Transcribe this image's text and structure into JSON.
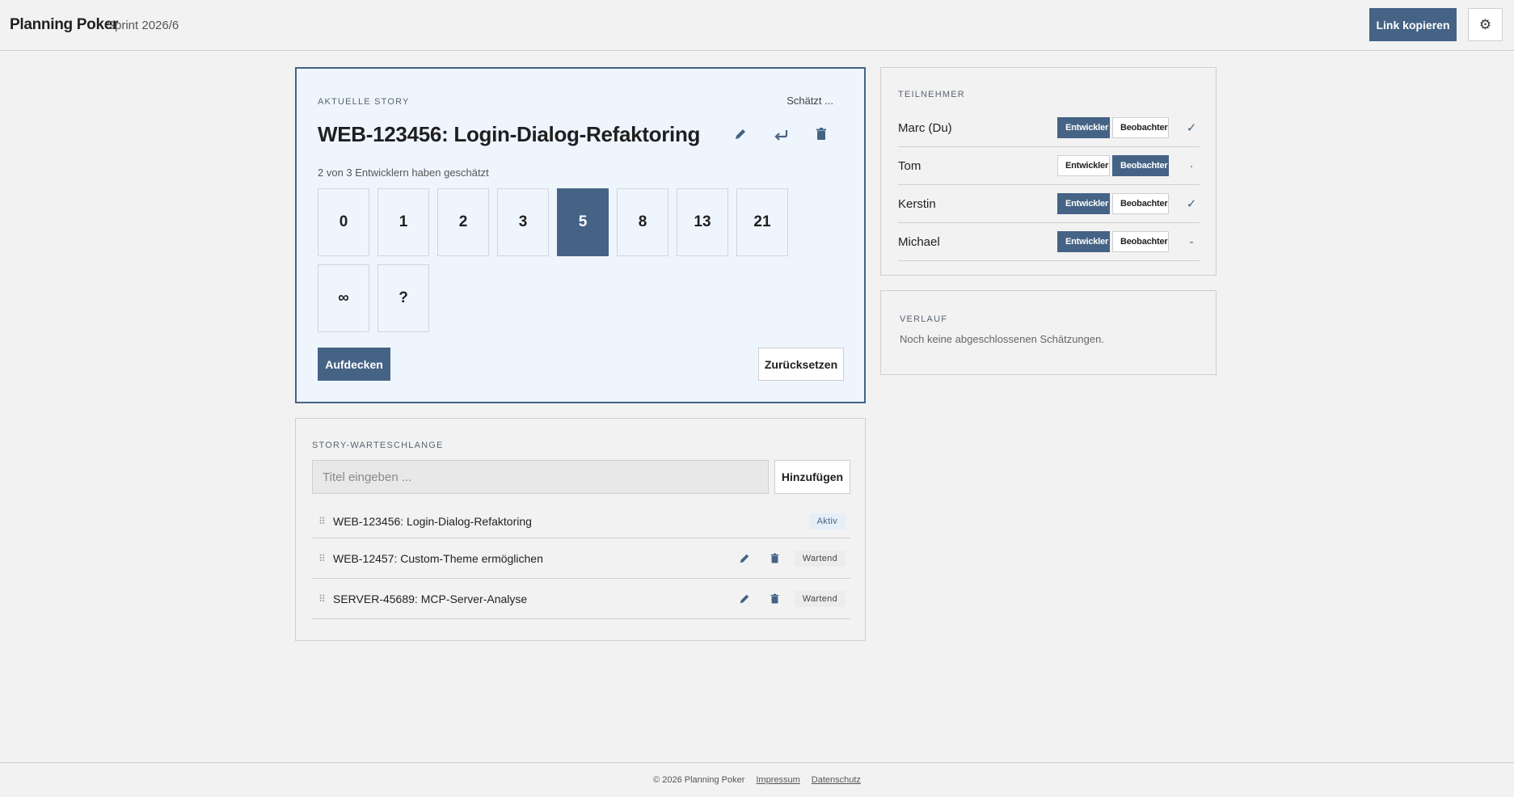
{
  "header": {
    "app_title": "Planning Poker",
    "sprint": "Sprint 2026/6",
    "copy_link_label": "Link kopieren",
    "settings_icon": "gear-icon"
  },
  "story": {
    "section_label": "AKTUELLE STORY",
    "status": "Schätzt ...",
    "title": "WEB-123456: Login-Dialog-Refaktoring",
    "icons": [
      "pencil-icon",
      "undo-arrow-icon",
      "trash-icon"
    ],
    "vote_progress": "2 von 3 Entwicklern haben geschätzt",
    "cards": [
      "0",
      "1",
      "2",
      "3",
      "5",
      "8",
      "13",
      "21",
      "∞",
      "?"
    ],
    "selected_card": "5",
    "reveal_label": "Aufdecken",
    "reset_label": "Zurücksetzen"
  },
  "queue": {
    "section_label": "STORY-WARTESCHLANGE",
    "input_placeholder": "Titel eingeben ...",
    "add_label": "Hinzufügen",
    "items": [
      {
        "title": "WEB-123456: Login-Dialog-Refaktoring",
        "status": "Aktiv"
      },
      {
        "title": "WEB-12457: Custom-Theme ermöglichen",
        "status": "Wartend"
      },
      {
        "title": "SERVER-45689: MCP-Server-Analyse",
        "status": "Wartend"
      }
    ]
  },
  "participants": {
    "section_label": "TEILNEHMER",
    "role_developer": "Entwickler",
    "role_observer": "Beobachter",
    "list": [
      {
        "name": "Marc (Du)",
        "role": "Entwickler",
        "state": "✓"
      },
      {
        "name": "Tom",
        "role": "Beobachter",
        "state": "·"
      },
      {
        "name": "Kerstin",
        "role": "Entwickler",
        "state": "✓"
      },
      {
        "name": "Michael",
        "role": "Entwickler",
        "state": "-"
      }
    ]
  },
  "history": {
    "section_label": "VERLAUF",
    "empty_text": "Noch keine abgeschlossenen Schätzungen."
  },
  "footer": {
    "copyright": "© 2026 Planning Poker",
    "imprint": "Impressum",
    "privacy": "Datenschutz"
  },
  "colors": {
    "accent": "#456385",
    "background": "#f2f2f2",
    "story_background": "#eef5fd"
  }
}
